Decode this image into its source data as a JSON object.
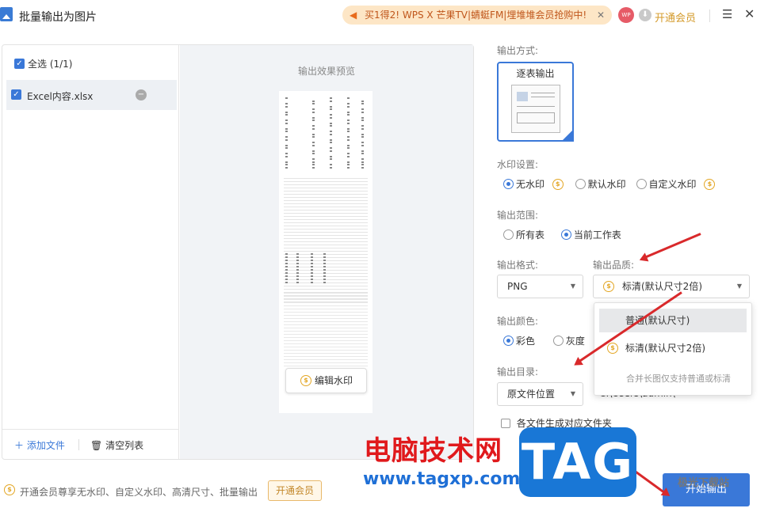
{
  "window": {
    "title": "批量输出为图片"
  },
  "promo_banner": {
    "text": "买1得2! WPS X 芒果TV|蜻蜓FM|埋堆堆会员抢购中!",
    "close": "✕"
  },
  "header": {
    "avatar_text": "WP",
    "vip_link": "开通会员",
    "menu_icon": "menu-icon",
    "close_icon": "close-icon"
  },
  "file_list": {
    "select_all": "全选 (1/1)",
    "items": [
      {
        "name": "Excel内容.xlsx",
        "checked": true
      }
    ],
    "add_file": "添加文件",
    "clear_list": "清空列表"
  },
  "preview": {
    "label": "输出效果预览",
    "edit_watermark": "编辑水印"
  },
  "settings": {
    "output_mode_label": "输出方式:",
    "output_mode_selected": "逐表输出",
    "watermark_label": "水印设置:",
    "watermark_options": [
      "无水印",
      "默认水印",
      "自定义水印"
    ],
    "watermark_selected": "无水印",
    "range_label": "输出范围:",
    "range_options": [
      "所有表",
      "当前工作表"
    ],
    "range_selected": "当前工作表",
    "format_label": "输出格式:",
    "format_value": "PNG",
    "quality_label": "输出品质:",
    "quality_value": "标清(默认尺寸2倍)",
    "quality_options": [
      "普通(默认尺寸)",
      "标清(默认尺寸2倍)"
    ],
    "quality_note": "合并长图仅支持普通或标清",
    "color_label": "输出颜色:",
    "color_options": [
      "彩色",
      "灰度"
    ],
    "color_selected": "彩色",
    "dir_label": "输出目录:",
    "dir_value": "原文件位置",
    "dir_path": "C:\\Users\\admin\\",
    "subfolder_label": "各文件生成对应文件夹"
  },
  "footer": {
    "promo_text": "开通会员尊享无水印、自定义水印、高清尺寸、批量输出",
    "vip_button": "开通会员",
    "start_button": "开始输出"
  },
  "overlay_watermark": {
    "cn": "电脑技术网",
    "url": "www.tagxp.com",
    "tag": "TAG",
    "brand": "极光下载站"
  },
  "colors": {
    "accent": "#3a78d8",
    "vip_gold": "#e3a624",
    "annotation_red": "#d9292b"
  }
}
